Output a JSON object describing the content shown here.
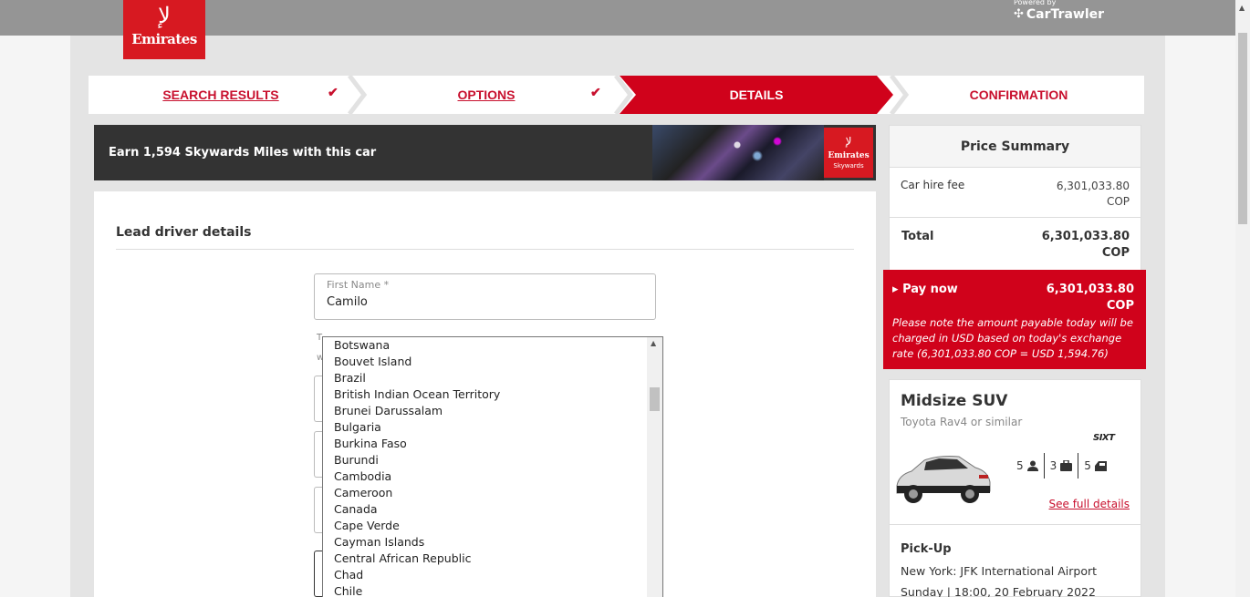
{
  "header": {
    "logo_text": "Emirates",
    "powered_by": "Powered by",
    "partner_brand": "CarTrawler"
  },
  "steps": [
    {
      "label": "SEARCH RESULTS",
      "done": true
    },
    {
      "label": "OPTIONS",
      "done": true
    },
    {
      "label": "DETAILS",
      "active": true
    },
    {
      "label": "CONFIRMATION"
    }
  ],
  "check_glyph": "✔",
  "banner": {
    "text": "Earn 1,594 Skywards Miles with this car",
    "badge_line1": "Emirates",
    "badge_line2": "Skywards"
  },
  "form": {
    "heading": "Lead driver details",
    "first_name": {
      "label": "First Name *",
      "value": "Camilo"
    },
    "hint_start": "T",
    "hint_start2": "w"
  },
  "country_dropdown": {
    "options": [
      "Botswana",
      "Bouvet Island",
      "Brazil",
      "British Indian Ocean Territory",
      "Brunei Darussalam",
      "Bulgaria",
      "Burkina Faso",
      "Burundi",
      "Cambodia",
      "Cameroon",
      "Canada",
      "Cape Verde",
      "Cayman Islands",
      "Central African Republic",
      "Chad",
      "Chile"
    ]
  },
  "price_summary": {
    "title": "Price Summary",
    "car_hire_label": "Car hire fee",
    "car_hire_amount": "6,301,033.80",
    "car_hire_currency": "COP",
    "total_label": "Total",
    "total_amount": "6,301,033.80",
    "total_currency": "COP",
    "pay_now_label": "Pay now",
    "pay_now_amount": "6,301,033.80",
    "pay_now_currency": "COP",
    "note": "Please note the amount payable today will be charged in USD based on today's exchange rate (6,301,033.80 COP = USD 1,594.76)"
  },
  "car": {
    "category": "Midsize SUV",
    "model": "Toyota Rav4 or similar",
    "supplier": "SIXT",
    "passengers": "5",
    "bags": "3",
    "doors": "5",
    "details_link": "See full details",
    "pickup_heading": "Pick-Up",
    "pickup_location": "New York: JFK International Airport",
    "pickup_datetime": "Sunday | 18:00, 20 February 2022"
  },
  "colors": {
    "brand_red": "#d71921",
    "topbar": "#959595"
  }
}
